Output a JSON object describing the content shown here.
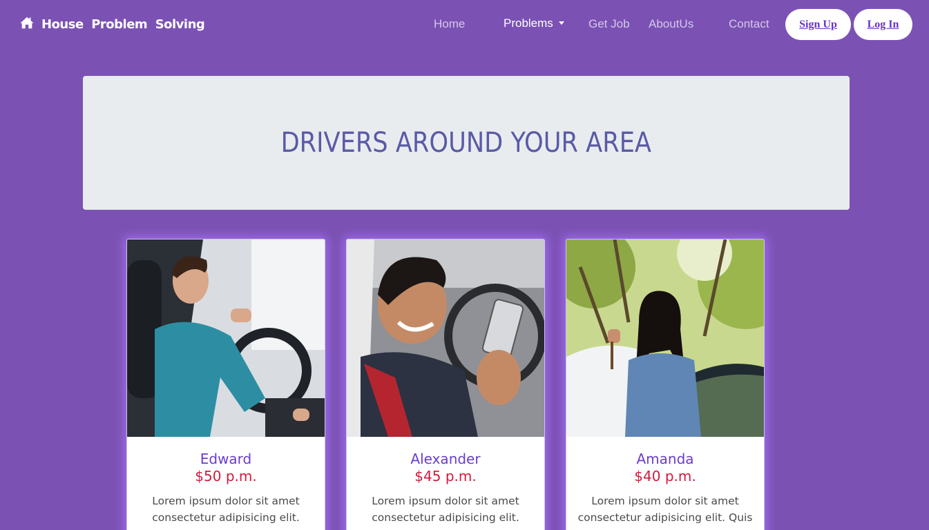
{
  "navbar": {
    "brand": "House  Problem  Solving",
    "links": [
      {
        "label": "Home"
      },
      {
        "label": "Problems"
      },
      {
        "label": "Get Job"
      },
      {
        "label": "AboutUs"
      },
      {
        "label": "Contact"
      }
    ],
    "signup_label": "Sign Up",
    "login_label": "Log In"
  },
  "hero": {
    "title": "DRIVERS AROUND YOUR AREA"
  },
  "drivers": [
    {
      "name": "Edward",
      "price": "$50 p.m.",
      "description": "Lorem ipsum dolor sit amet consectetur adipisicing elit."
    },
    {
      "name": "Alexander",
      "price": "$45 p.m.",
      "description": "Lorem ipsum dolor sit amet consectetur adipisicing elit. Nemo"
    },
    {
      "name": "Amanda",
      "price": "$40 p.m.",
      "description": "Lorem ipsum dolor sit amet consectetur adipisicing elit. Quis"
    }
  ],
  "colors": {
    "page_bg": "#7b52b3",
    "hero_bg": "#e9ecef",
    "hero_text": "#5a5aa6",
    "name_text": "#6a3ccc",
    "price_text": "#d11a3c",
    "card_glow": "#a26ef5"
  }
}
